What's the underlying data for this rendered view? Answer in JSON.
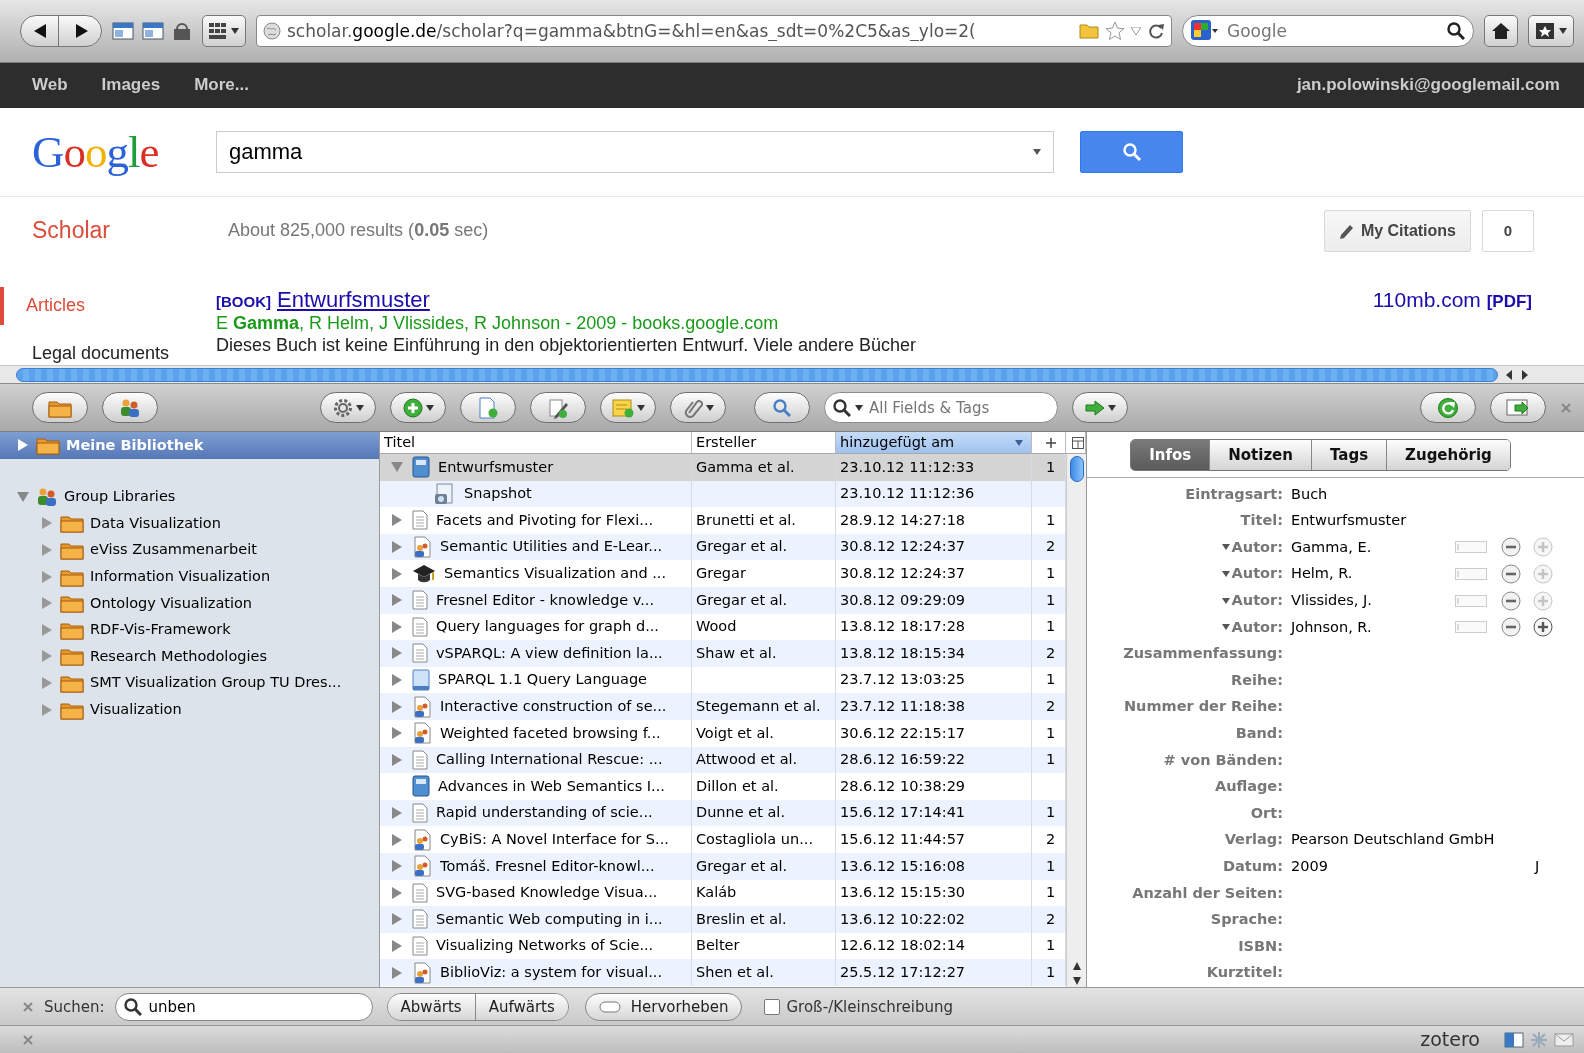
{
  "browser": {
    "url": "scholar.**google.de**/scholar?q=gamma&btnG=&hl=en&as_sdt=0%2C5&as_ylo=2(",
    "search_placeholder": "Google"
  },
  "google_bar": {
    "links": [
      "Web",
      "Images",
      "More..."
    ],
    "account": "jan.polowinski@googlemail.com"
  },
  "google_header": {
    "logo": "Google",
    "query": "gamma"
  },
  "scholar_bar": {
    "title": "Scholar",
    "results": "About 825,000 results (**0.05** sec)",
    "my_citations": "My Citations",
    "citation_count": "0"
  },
  "scholar_nav": [
    {
      "label": "Articles",
      "selected": true
    },
    {
      "label": "Legal documents",
      "selected": false
    }
  ],
  "result": {
    "tag": "[BOOK]",
    "title": "Entwurfsmuster",
    "authors": "E **Gamma**, R Helm, J Vlissides, R Johnson - 2009 - books.google.com",
    "snippet": "Dieses Buch ist keine Einführung in den objektorientierten Entwurf. Viele andere Bücher",
    "side_link": "110mb.com",
    "side_tag": "[PDF]"
  },
  "zotero_toolbar": {
    "search_placeholder": "All Fields & Tags"
  },
  "collections": [
    {
      "label": "Meine Bibliothek",
      "kind": "library",
      "selected": true,
      "expanded": false
    },
    {
      "label": "Group Libraries",
      "kind": "group",
      "selected": false,
      "expanded": true,
      "children": [
        {
          "label": "Data Visualization",
          "kind": "folder",
          "selected": false,
          "expanded": false
        },
        {
          "label": "eViss Zusammenarbeit",
          "kind": "folder",
          "selected": false,
          "expanded": false
        },
        {
          "label": "Information Visualization",
          "kind": "folder",
          "selected": false,
          "expanded": false
        },
        {
          "label": "Ontology Visualization",
          "kind": "folder",
          "selected": false,
          "expanded": false
        },
        {
          "label": "RDF-Vis-Framework",
          "kind": "folder",
          "selected": false,
          "expanded": false
        },
        {
          "label": "Research Methodologies",
          "kind": "folder",
          "selected": false,
          "expanded": false
        },
        {
          "label": "SMT Visualization Group TU Dres...",
          "kind": "folder",
          "selected": false,
          "expanded": false
        },
        {
          "label": "Visualization",
          "kind": "folder",
          "selected": false,
          "expanded": false
        }
      ]
    }
  ],
  "items": {
    "columns": [
      {
        "label": "Titel",
        "sorted": false
      },
      {
        "label": "Ersteller",
        "sorted": false
      },
      {
        "label": "hinzugefügt am",
        "sorted": true
      }
    ],
    "rows": [
      {
        "title": "Entwurfsmuster",
        "creator": "Gamma et al.",
        "added": "23.10.12 11:12:33",
        "count": "1",
        "kind": "book",
        "expanded": true,
        "selected": true,
        "children": [
          {
            "title": "Snapshot",
            "added": "23.10.12 11:12:36",
            "kind": "snapshot",
            "selected": false
          }
        ]
      },
      {
        "title": "Facets and Pivoting for Flexi...",
        "creator": "Brunetti et al.",
        "added": "28.9.12 14:27:18",
        "count": "1",
        "kind": "document",
        "expanded": false,
        "selected": false
      },
      {
        "title": "Semantic Utilities and E-Lear...",
        "creator": "Gregar et al.",
        "added": "30.8.12 12:24:37",
        "count": "2",
        "kind": "paper",
        "expanded": false,
        "selected": false
      },
      {
        "title": "Semantics Visualization and ...",
        "creator": "Gregar",
        "added": "30.8.12 12:24:37",
        "count": "1",
        "kind": "thesis",
        "expanded": false,
        "selected": false
      },
      {
        "title": "Fresnel Editor - knowledge v...",
        "creator": "Gregar et al.",
        "added": "30.8.12 09:29:09",
        "count": "1",
        "kind": "document",
        "expanded": false,
        "selected": false
      },
      {
        "title": "Query languages for graph d...",
        "creator": "Wood",
        "added": "13.8.12 18:17:28",
        "count": "1",
        "kind": "document",
        "expanded": false,
        "selected": false
      },
      {
        "title": "vSPARQL: A view definition la...",
        "creator": "Shaw et al.",
        "added": "13.8.12 18:15:34",
        "count": "2",
        "kind": "document",
        "expanded": false,
        "selected": false
      },
      {
        "title": "SPARQL 1.1 Query Language",
        "added": "23.7.12 13:03:25",
        "count": "1",
        "kind": "webpage",
        "expanded": false,
        "selected": false
      },
      {
        "title": "Interactive construction of se...",
        "creator": "Stegemann et al.",
        "added": "23.7.12 11:18:38",
        "count": "2",
        "kind": "paper",
        "expanded": false,
        "selected": false
      },
      {
        "title": "Weighted faceted browsing f...",
        "creator": "Voigt et al.",
        "added": "30.6.12 22:15:17",
        "count": "1",
        "kind": "paper",
        "expanded": false,
        "selected": false
      },
      {
        "title": "Calling International Rescue: ...",
        "creator": "Attwood et al.",
        "added": "28.6.12 16:59:22",
        "count": "1",
        "kind": "document",
        "expanded": false,
        "selected": false
      },
      {
        "title": "Advances in Web Semantics I...",
        "creator": "Dillon et al.",
        "added": "28.6.12 10:38:29",
        "kind": "book",
        "selected": false
      },
      {
        "title": "Rapid understanding of scie...",
        "creator": "Dunne et al.",
        "added": "15.6.12 17:14:41",
        "count": "1",
        "kind": "document",
        "expanded": false,
        "selected": false
      },
      {
        "title": "CyBiS: A Novel Interface for S...",
        "creator": "Costagliola un...",
        "added": "15.6.12 11:44:57",
        "count": "2",
        "kind": "paper",
        "expanded": false,
        "selected": false
      },
      {
        "title": "Tomáš. Fresnel Editor-knowl...",
        "creator": "Gregar et al.",
        "added": "13.6.12 15:16:08",
        "count": "1",
        "kind": "paper",
        "expanded": false,
        "selected": false
      },
      {
        "title": "SVG-based Knowledge Visua...",
        "creator": "Kaláb",
        "added": "13.6.12 15:15:30",
        "count": "1",
        "kind": "document",
        "expanded": false,
        "selected": false
      },
      {
        "title": "Semantic Web computing in i...",
        "creator": "Breslin et al.",
        "added": "13.6.12 10:22:02",
        "count": "2",
        "kind": "document",
        "expanded": false,
        "selected": false
      },
      {
        "title": "Visualizing Networks of Scie...",
        "creator": "Belter",
        "added": "12.6.12 18:02:14",
        "count": "1",
        "kind": "document",
        "expanded": false,
        "selected": false
      },
      {
        "title": "BiblioViz: a system for visual...",
        "creator": "Shen et al.",
        "added": "25.5.12 17:12:27",
        "count": "1",
        "kind": "paper",
        "expanded": false,
        "selected": false
      }
    ]
  },
  "info_pane": {
    "tabs": [
      {
        "label": "Infos",
        "selected": true
      },
      {
        "label": "Notizen",
        "selected": false
      },
      {
        "label": "Tags",
        "selected": false
      },
      {
        "label": "Zugehörig",
        "selected": false
      }
    ],
    "fields": [
      {
        "label": "Eintragsart:",
        "value": "Buch",
        "kind": "field"
      },
      {
        "label": "Titel:",
        "value": "Entwurfsmuster",
        "kind": "field"
      },
      {
        "label": "Autor:",
        "value": "Gamma, E.",
        "kind": "creator",
        "add_enabled": false
      },
      {
        "label": "Autor:",
        "value": "Helm, R.",
        "kind": "creator",
        "add_enabled": false
      },
      {
        "label": "Autor:",
        "value": "Vlissides, J.",
        "kind": "creator",
        "add_enabled": false
      },
      {
        "label": "Autor:",
        "value": "Johnson, R.",
        "kind": "creator",
        "add_enabled": true
      },
      {
        "label": "Zusammenfassung:",
        "kind": "field"
      },
      {
        "label": "Reihe:",
        "kind": "field"
      },
      {
        "label": "Nummer der Reihe:",
        "kind": "field"
      },
      {
        "label": "Band:",
        "kind": "field"
      },
      {
        "label": "# von Bänden:",
        "kind": "field"
      },
      {
        "label": "Auflage:",
        "kind": "field"
      },
      {
        "label": "Ort:",
        "kind": "field"
      },
      {
        "label": "Verlag:",
        "value": "Pearson Deutschland GmbH",
        "kind": "field"
      },
      {
        "label": "Datum:",
        "value": "2009",
        "kind": "field",
        "date_order": "J"
      },
      {
        "label": "Anzahl der Seiten:",
        "kind": "field"
      },
      {
        "label": "Sprache:",
        "kind": "field"
      },
      {
        "label": "ISBN:",
        "kind": "field"
      },
      {
        "label": "Kurztitel:",
        "kind": "field"
      }
    ]
  },
  "find_bar": {
    "label": "Suchen:",
    "value": "unben",
    "buttons": [
      "Abwärts",
      "Aufwärts"
    ],
    "highlight": {
      "label": "Hervorheben",
      "on": false
    },
    "match_case": {
      "label": "Groß-/Kleinschreibung",
      "checked": false
    }
  },
  "status_bar": {
    "brand": "zotero"
  }
}
